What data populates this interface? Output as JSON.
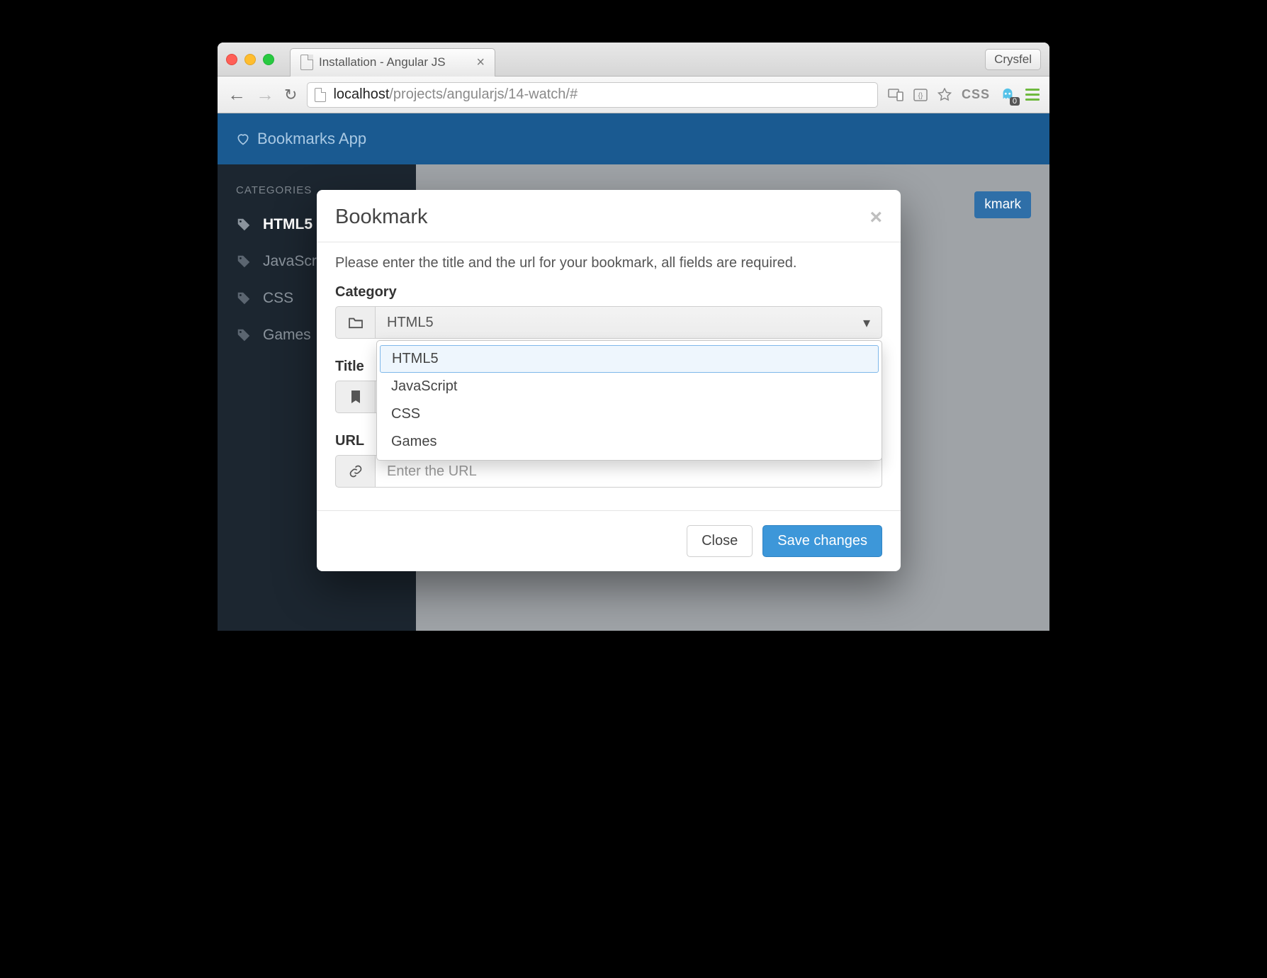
{
  "browser": {
    "tab_title": "Installation - Angular JS",
    "profile_name": "Crysfel",
    "url_host": "localhost",
    "url_path": "/projects/angularjs/14-watch/#",
    "ext_css_label": "CSS",
    "ghost_count": "0"
  },
  "app": {
    "brand": "Bookmarks App",
    "sidebar_heading": "CATEGORIES",
    "sidebar_items": [
      {
        "label": "HTML5",
        "active": true
      },
      {
        "label": "JavaScript",
        "active": false
      },
      {
        "label": "CSS",
        "active": false
      },
      {
        "label": "Games",
        "active": false
      }
    ],
    "new_bookmark_btn_partial": "kmark"
  },
  "modal": {
    "title": "Bookmark",
    "intro": "Please enter the title and the url for your bookmark, all fields are required.",
    "category_label": "Category",
    "category_value": "HTML5",
    "category_options": [
      "HTML5",
      "JavaScript",
      "CSS",
      "Games"
    ],
    "title_label": "Title",
    "url_label": "URL",
    "url_placeholder": "Enter the URL",
    "close_btn": "Close",
    "save_btn": "Save changes"
  }
}
